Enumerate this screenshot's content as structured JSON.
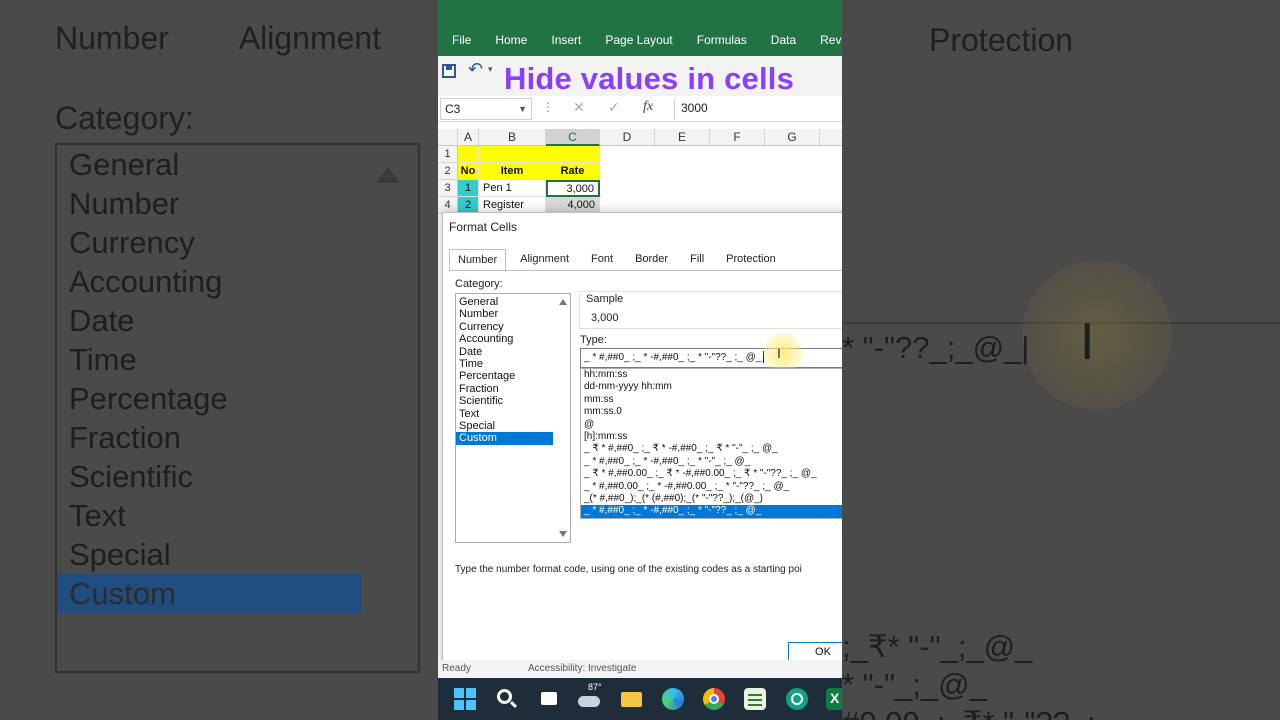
{
  "background": {
    "tabs": [
      "Number",
      "Alignment"
    ],
    "right_tab": "Protection",
    "category_label": "Category:",
    "categories": [
      "General",
      "Number",
      "Currency",
      "Accounting",
      "Date",
      "Time",
      "Percentage",
      "Fraction",
      "Scientific",
      "Text",
      "Special",
      "Custom"
    ],
    "right_type_text": "* \"-\"??_;_@_|",
    "right_bottom_lines": [
      ";_₹* \"-\"_;_@_",
      "* \"-\"_;_@_",
      "#0.00_;_₹* \"-\"??_;_"
    ]
  },
  "ribbon": {
    "tabs": [
      "File",
      "Home",
      "Insert",
      "Page Layout",
      "Formulas",
      "Data",
      "Revi"
    ]
  },
  "overlay_title": "Hide values in cells",
  "formula_bar": {
    "name_box": "C3",
    "fx": "fx",
    "value": "3000"
  },
  "sheet": {
    "columns": [
      "A",
      "B",
      "C",
      "D",
      "E",
      "F",
      "G"
    ],
    "rows": [
      "1",
      "2",
      "3",
      "4"
    ],
    "cells": {
      "a2": "No",
      "b2": "Item",
      "c2": "Rate",
      "a3": "1",
      "b3": "Pen 1",
      "c3": "3,000",
      "a4": "2",
      "b4": "Register",
      "c4": "4,000"
    }
  },
  "dialog": {
    "title": "Format Cells",
    "tabs": [
      "Number",
      "Alignment",
      "Font",
      "Border",
      "Fill",
      "Protection"
    ],
    "category_label": "Category:",
    "categories": [
      "General",
      "Number",
      "Currency",
      "Accounting",
      "Date",
      "Time",
      "Percentage",
      "Fraction",
      "Scientific",
      "Text",
      "Special",
      "Custom"
    ],
    "selected_category": "Custom",
    "sample_label": "Sample",
    "sample_value": "3,000",
    "type_label": "Type:",
    "type_value": "_ * #,##0_ ;_ * -#,##0_ ;_ * \"-\"??_ ;_ @_",
    "type_list": [
      "hh:mm:ss",
      "dd-mm-yyyy hh:mm",
      "mm:ss",
      "mm:ss.0",
      "@",
      "[h]:mm:ss",
      "_ ₹ * #,##0_ ;_ ₹ * -#,##0_ ;_ ₹ * \"-\"_ ;_ @_",
      "_ * #,##0_ ;_ * -#,##0_ ;_ * \"-\"_ ;_ @_",
      "_ ₹ * #,##0.00_ ;_ ₹ * -#,##0.00_ ;_ ₹ * \"-\"??_ ;_ @_",
      "_ * #,##0.00_ ;_ * -#,##0.00_ ;_ * \"-\"??_ ;_ @_",
      "_(* #,##0_);_(* (#,##0);_(* \"-\"??_);_(@_)",
      "_ * #,##0_ ;_ * -#,##0_ ;_ * \"-\"??_ ;_ @_"
    ],
    "selected_type_index": 11,
    "hint": "Type the number format code, using one of the existing codes as a starting poi",
    "ok_label": "OK"
  },
  "status_bar": {
    "ready": "Ready",
    "accessibility": "Accessibility: Investigate"
  },
  "taskbar": {
    "weather_temp": "87°"
  },
  "colors": {
    "excel_green": "#217346",
    "title_purple": "#8a3ffc",
    "header_yellow": "#ffff00",
    "selection_blue": "#0078d7",
    "cyan_cells": "#33cccc"
  }
}
